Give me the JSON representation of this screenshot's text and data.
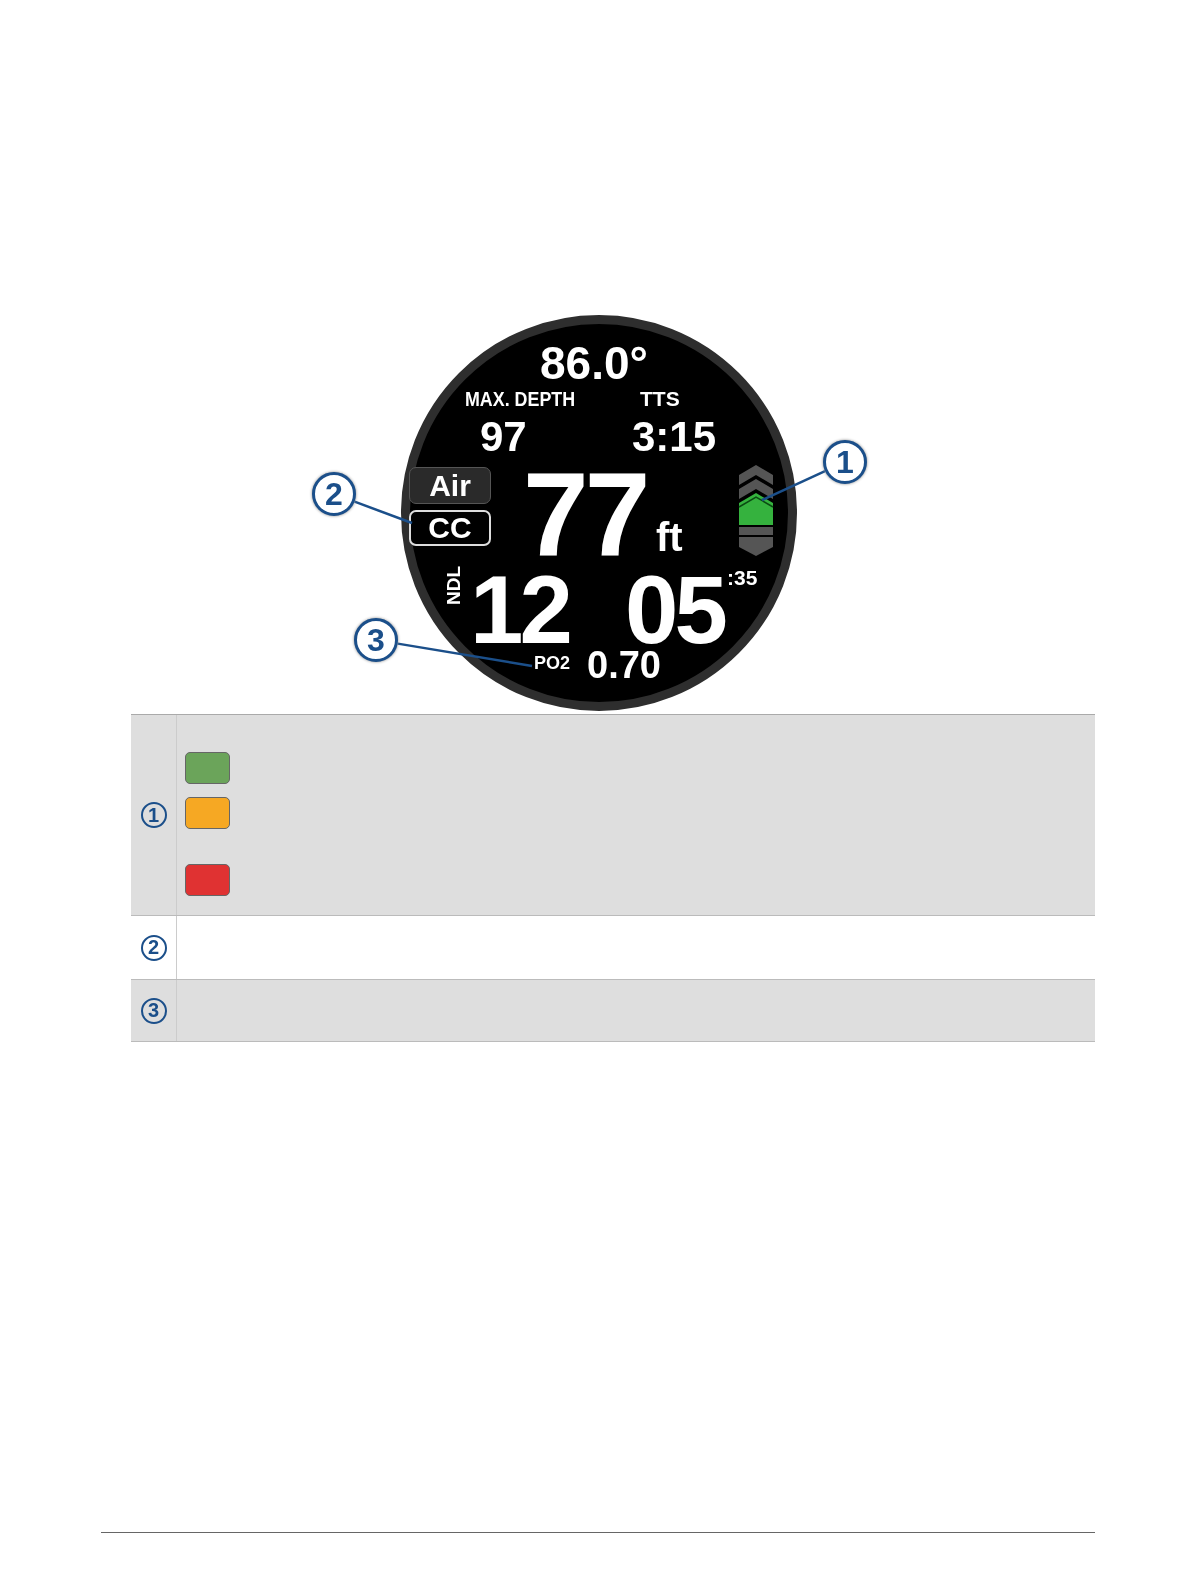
{
  "watch": {
    "temperature": "86.0°",
    "max_depth": {
      "label": "MAX. DEPTH",
      "value": "97"
    },
    "tts": {
      "label": "TTS",
      "value": "3:15"
    },
    "gas": "Air",
    "mode": "CC",
    "depth": {
      "value": "77",
      "unit": "ft"
    },
    "ndl": {
      "label": "NDL",
      "minutes": "12",
      "seconds": "05",
      "fraction": ":35"
    },
    "po2": {
      "label": "PO2",
      "value": "0.70"
    }
  },
  "callouts": [
    "1",
    "2",
    "3"
  ],
  "legend": [
    {
      "marker": "1",
      "swatches": [
        {
          "color": "#6ba45a"
        },
        {
          "color": "#f6a823"
        },
        {
          "color": "#e03232"
        }
      ]
    },
    {
      "marker": "2"
    },
    {
      "marker": "3"
    }
  ]
}
